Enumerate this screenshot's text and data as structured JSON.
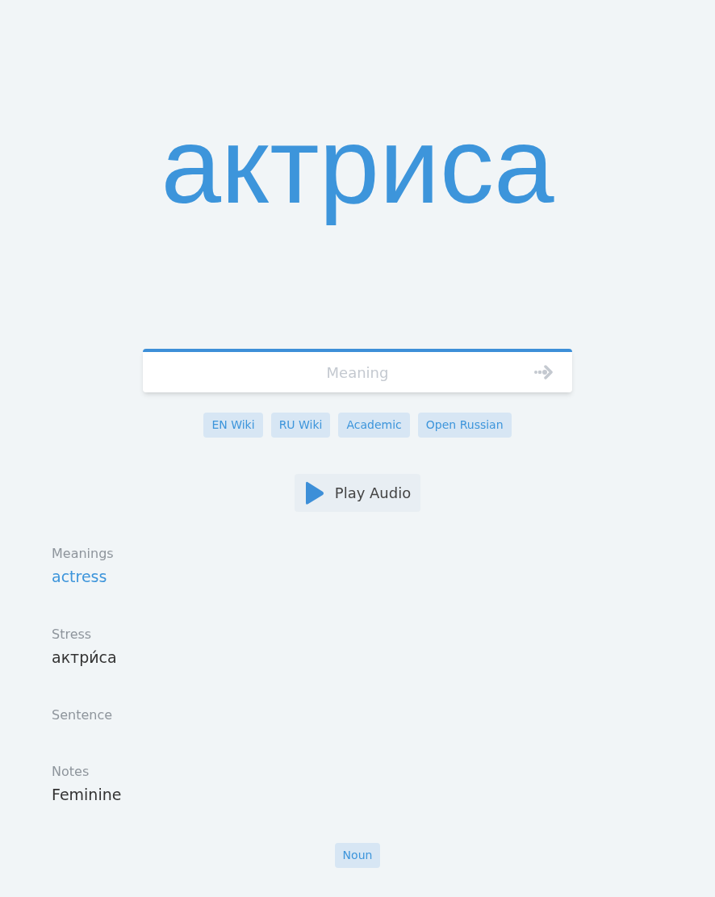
{
  "word": "актриса",
  "answer": {
    "placeholder": "Meaning"
  },
  "links": [
    "EN Wiki",
    "RU Wiki",
    "Academic",
    "Open Russian"
  ],
  "play_button": {
    "label": "Play Audio"
  },
  "fields": [
    {
      "label": "Meanings",
      "kind": "link",
      "value": "actress"
    },
    {
      "label": "Stress",
      "kind": "text",
      "value": "актри́са"
    },
    {
      "label": "Sentence",
      "kind": "empty"
    },
    {
      "label": "Notes",
      "kind": "text",
      "value": "Feminine"
    }
  ],
  "tags": [
    "Noun"
  ]
}
